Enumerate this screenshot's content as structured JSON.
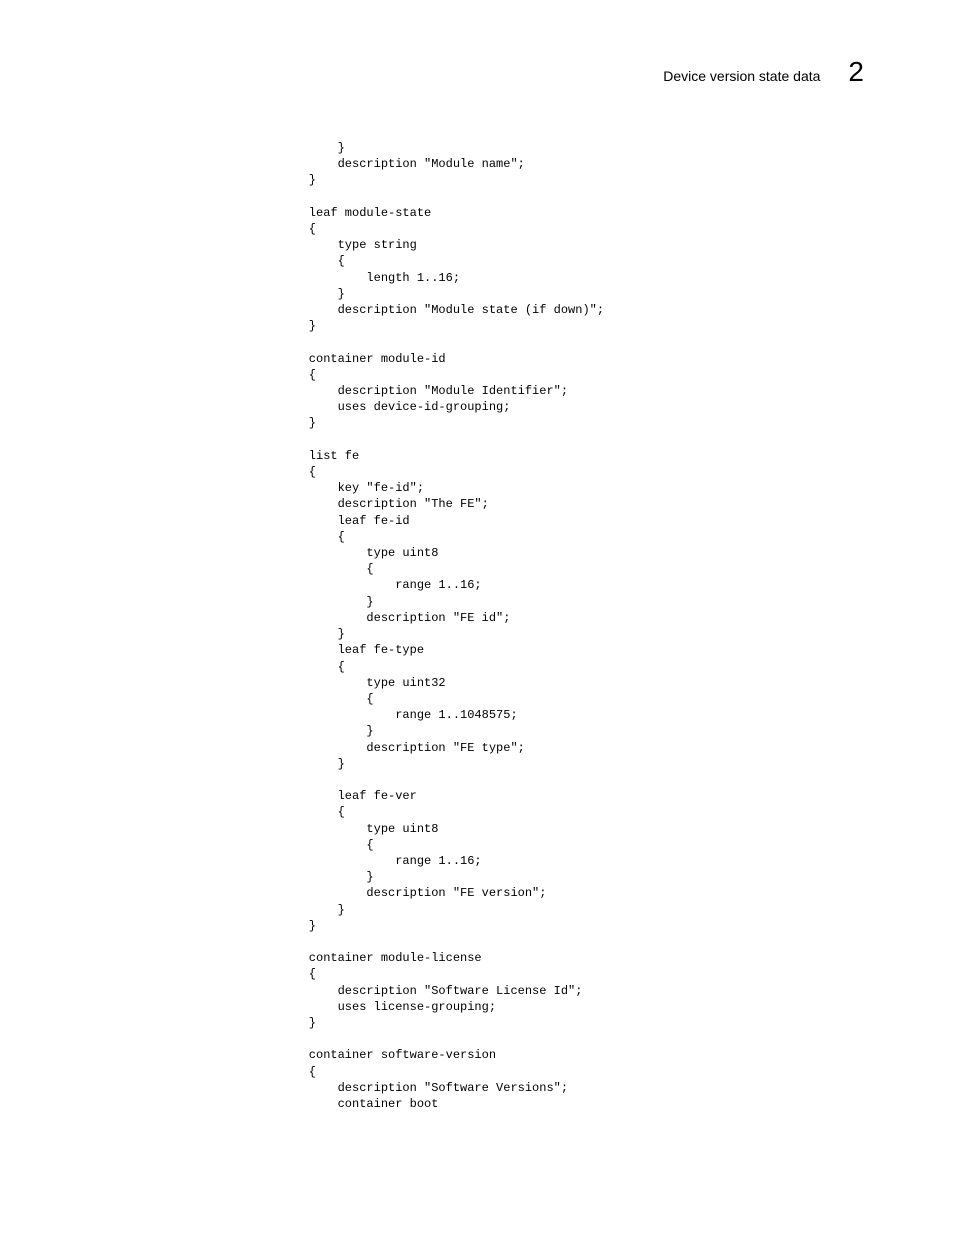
{
  "header": {
    "title": "Device version state data",
    "chapter_number": "2"
  },
  "code": "        }\n        description \"Module name\";\n    }\n\n    leaf module-state\n    {\n        type string\n        {\n            length 1..16;\n        }\n        description \"Module state (if down)\";\n    }\n\n    container module-id\n    {\n        description \"Module Identifier\";\n        uses device-id-grouping;\n    }\n\n    list fe\n    {\n        key \"fe-id\";\n        description \"The FE\";\n        leaf fe-id\n        {\n            type uint8\n            {\n                range 1..16;\n            }\n            description \"FE id\";\n        }\n        leaf fe-type\n        {\n            type uint32\n            {\n                range 1..1048575;\n            }\n            description \"FE type\";\n        }\n\n        leaf fe-ver\n        {\n            type uint8\n            {\n                range 1..16;\n            }\n            description \"FE version\";\n        }\n    }\n\n    container module-license\n    {\n        description \"Software License Id\";\n        uses license-grouping;\n    }\n\n    container software-version\n    {\n        description \"Software Versions\";\n        container boot"
}
